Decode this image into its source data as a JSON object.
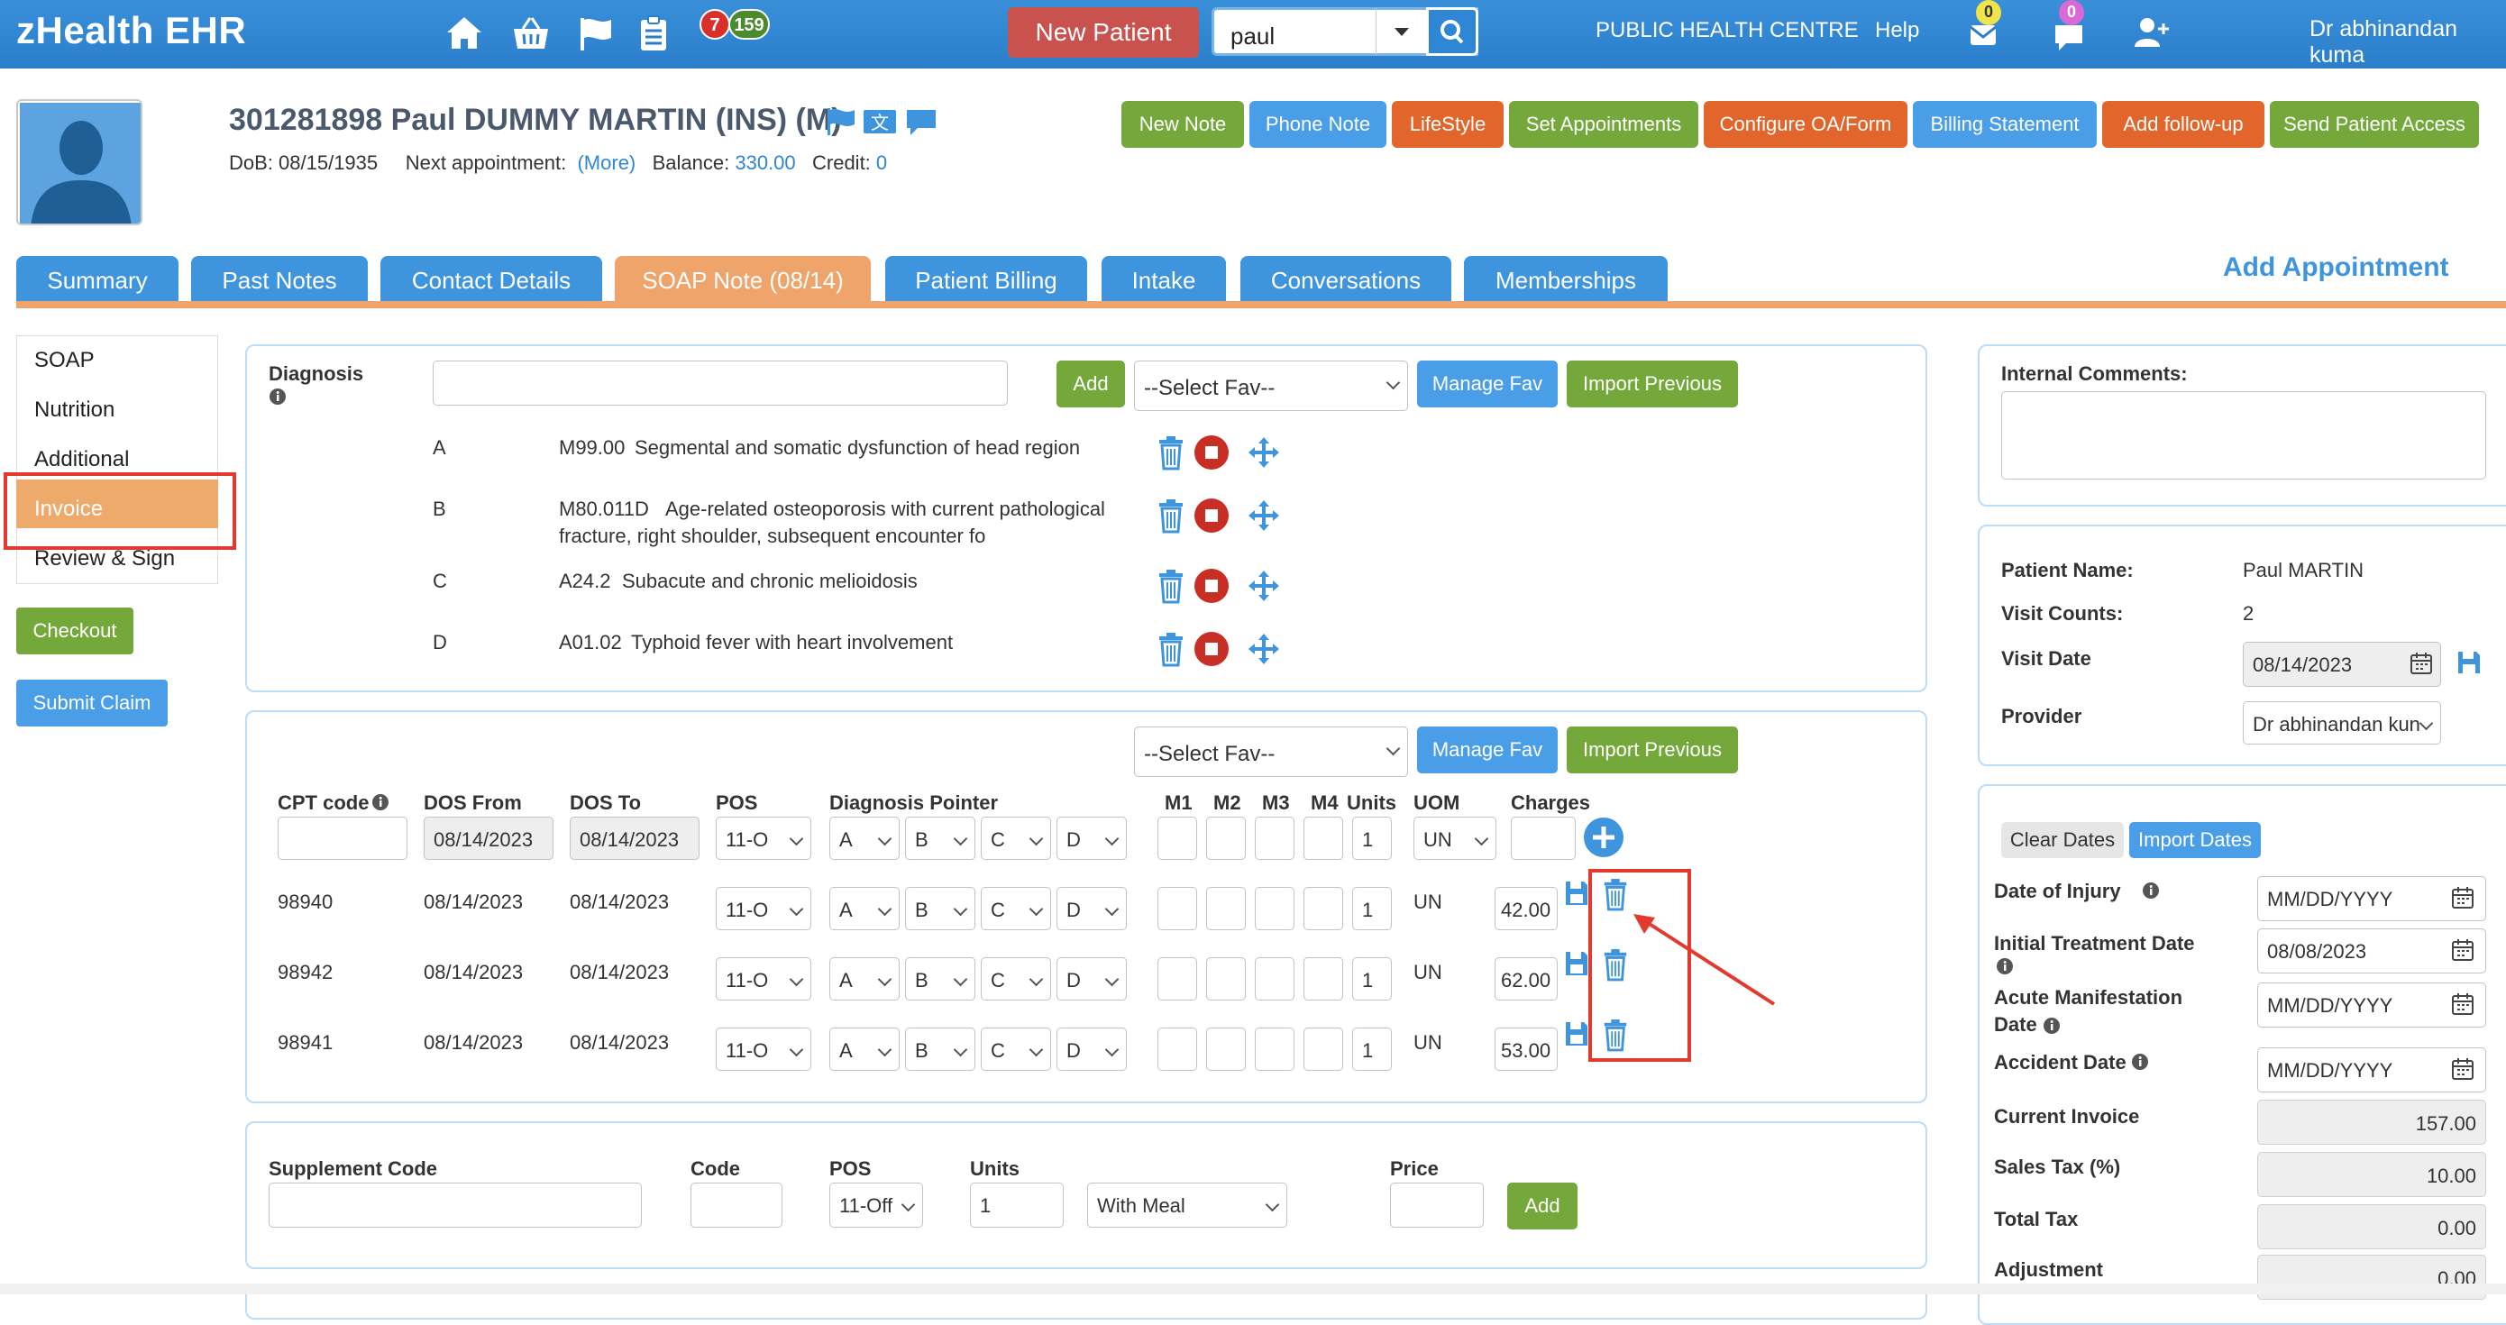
{
  "app": {
    "brand": "zHealth EHR",
    "badge_red": "7",
    "badge_green": "159",
    "new_patient": "New Patient",
    "search_value": "paul",
    "clinic": "PUBLIC HEALTH CENTRE",
    "help": "Help",
    "mail_count": "0",
    "chat_count": "0",
    "user": "Dr abhinandan kuma"
  },
  "patient": {
    "title": "301281898 Paul DUMMY MARTIN  (INS) (M)",
    "dob_label": "DoB: 08/15/1935",
    "next_label": "Next appointment:",
    "more": "(More)",
    "balance_label": "Balance:",
    "balance": "330.00",
    "credit_label": "Credit:",
    "credit": "0"
  },
  "header_buttons": {
    "new_note": "New Note",
    "phone_note": "Phone Note",
    "lifestyle": "LifeStyle",
    "set_appointments": "Set Appointments",
    "configure": "Configure OA/Form",
    "billing_statement": "Billing Statement",
    "add_followup": "Add follow-up",
    "send_access": "Send Patient Access"
  },
  "tabs": {
    "summary": "Summary",
    "past_notes": "Past Notes",
    "contact": "Contact Details",
    "soap": "SOAP Note (08/14)",
    "billing": "Patient Billing",
    "intake": "Intake",
    "conversations": "Conversations",
    "memberships": "Memberships"
  },
  "add_appointment": "Add Appointment",
  "leftnav": {
    "soap": "SOAP",
    "nutrition": "Nutrition",
    "additional": "Additional",
    "invoice": "Invoice",
    "review": "Review & Sign",
    "checkout": "Checkout",
    "submit_claim": "Submit Claim"
  },
  "diagnosis": {
    "label": "Diagnosis",
    "add": "Add",
    "select_fav": "--Select Fav--",
    "manage_fav": "Manage Fav",
    "import_previous": "Import Previous",
    "rows": [
      {
        "letter": "A",
        "code": "M99.00",
        "desc": "Segmental and somatic dysfunction of head region",
        "desc2": ""
      },
      {
        "letter": "B",
        "code": "M80.011D",
        "desc": "Age-related osteoporosis with current pathological",
        "desc2": "fracture, right shoulder, subsequent encounter fo"
      },
      {
        "letter": "C",
        "code": "A24.2",
        "desc": "Subacute and chronic melioidosis",
        "desc2": ""
      },
      {
        "letter": "D",
        "code": "A01.02",
        "desc": "Typhoid fever with heart involvement",
        "desc2": ""
      }
    ]
  },
  "cpt": {
    "select_fav": "--Select Fav--",
    "manage_fav": "Manage Fav",
    "import_previous": "Import Previous",
    "headers": {
      "cpt": "CPT code",
      "dos_from": "DOS From",
      "dos_to": "DOS To",
      "pos": "POS",
      "diag": "Diagnosis Pointer",
      "m1": "M1",
      "m2": "M2",
      "m3": "M3",
      "m4": "M4",
      "units": "Units",
      "uom": "UOM",
      "charges": "Charges"
    },
    "new_row": {
      "dos_from": "08/14/2023",
      "dos_to": "08/14/2023",
      "pos": "11-O",
      "a": "A",
      "b": "B",
      "c": "C",
      "d": "D",
      "units": "1",
      "uom": "UN"
    },
    "rows": [
      {
        "code": "98940",
        "dos_from": "08/14/2023",
        "dos_to": "08/14/2023",
        "pos": "11-O",
        "a": "A",
        "b": "B",
        "c": "C",
        "d": "D",
        "units": "1",
        "uom": "UN",
        "charge": "42.00"
      },
      {
        "code": "98942",
        "dos_from": "08/14/2023",
        "dos_to": "08/14/2023",
        "pos": "11-O",
        "a": "A",
        "b": "B",
        "c": "C",
        "d": "D",
        "units": "1",
        "uom": "UN",
        "charge": "62.00"
      },
      {
        "code": "98941",
        "dos_from": "08/14/2023",
        "dos_to": "08/14/2023",
        "pos": "11-O",
        "a": "A",
        "b": "B",
        "c": "C",
        "d": "D",
        "units": "1",
        "uom": "UN",
        "charge": "53.00"
      }
    ]
  },
  "supplement": {
    "label": "Supplement Code",
    "code": "Code",
    "pos": "POS",
    "units": "Units",
    "price": "Price",
    "pos_value": "11-Off",
    "units_value": "1",
    "meal": "With Meal",
    "add": "Add"
  },
  "right": {
    "internal_comments": "Internal Comments:",
    "patient_name_label": "Patient Name:",
    "patient_name": "Paul MARTIN",
    "visit_counts_label": "Visit Counts:",
    "visit_counts": "2",
    "visit_date_label": "Visit Date",
    "visit_date": "08/14/2023",
    "provider_label": "Provider",
    "provider": "Dr abhinandan kun",
    "clear_dates": "Clear Dates",
    "import_dates": "Import Dates",
    "injury_label": "Date of Injury",
    "injury": "MM/DD/YYYY",
    "initial_label": "Initial Treatment Date",
    "initial": "08/08/2023",
    "acute_label1": "Acute Manifestation",
    "acute_label2": "Date",
    "acute": "MM/DD/YYYY",
    "accident_label": "Accident Date",
    "accident": "MM/DD/YYYY",
    "current_invoice_label": "Current Invoice",
    "current_invoice": "157.00",
    "sales_tax_label": "Sales Tax (%)",
    "sales_tax": "10.00",
    "total_tax_label": "Total Tax",
    "total_tax": "0.00",
    "adjustment_label": "Adjustment",
    "adjustment": "0.00"
  }
}
